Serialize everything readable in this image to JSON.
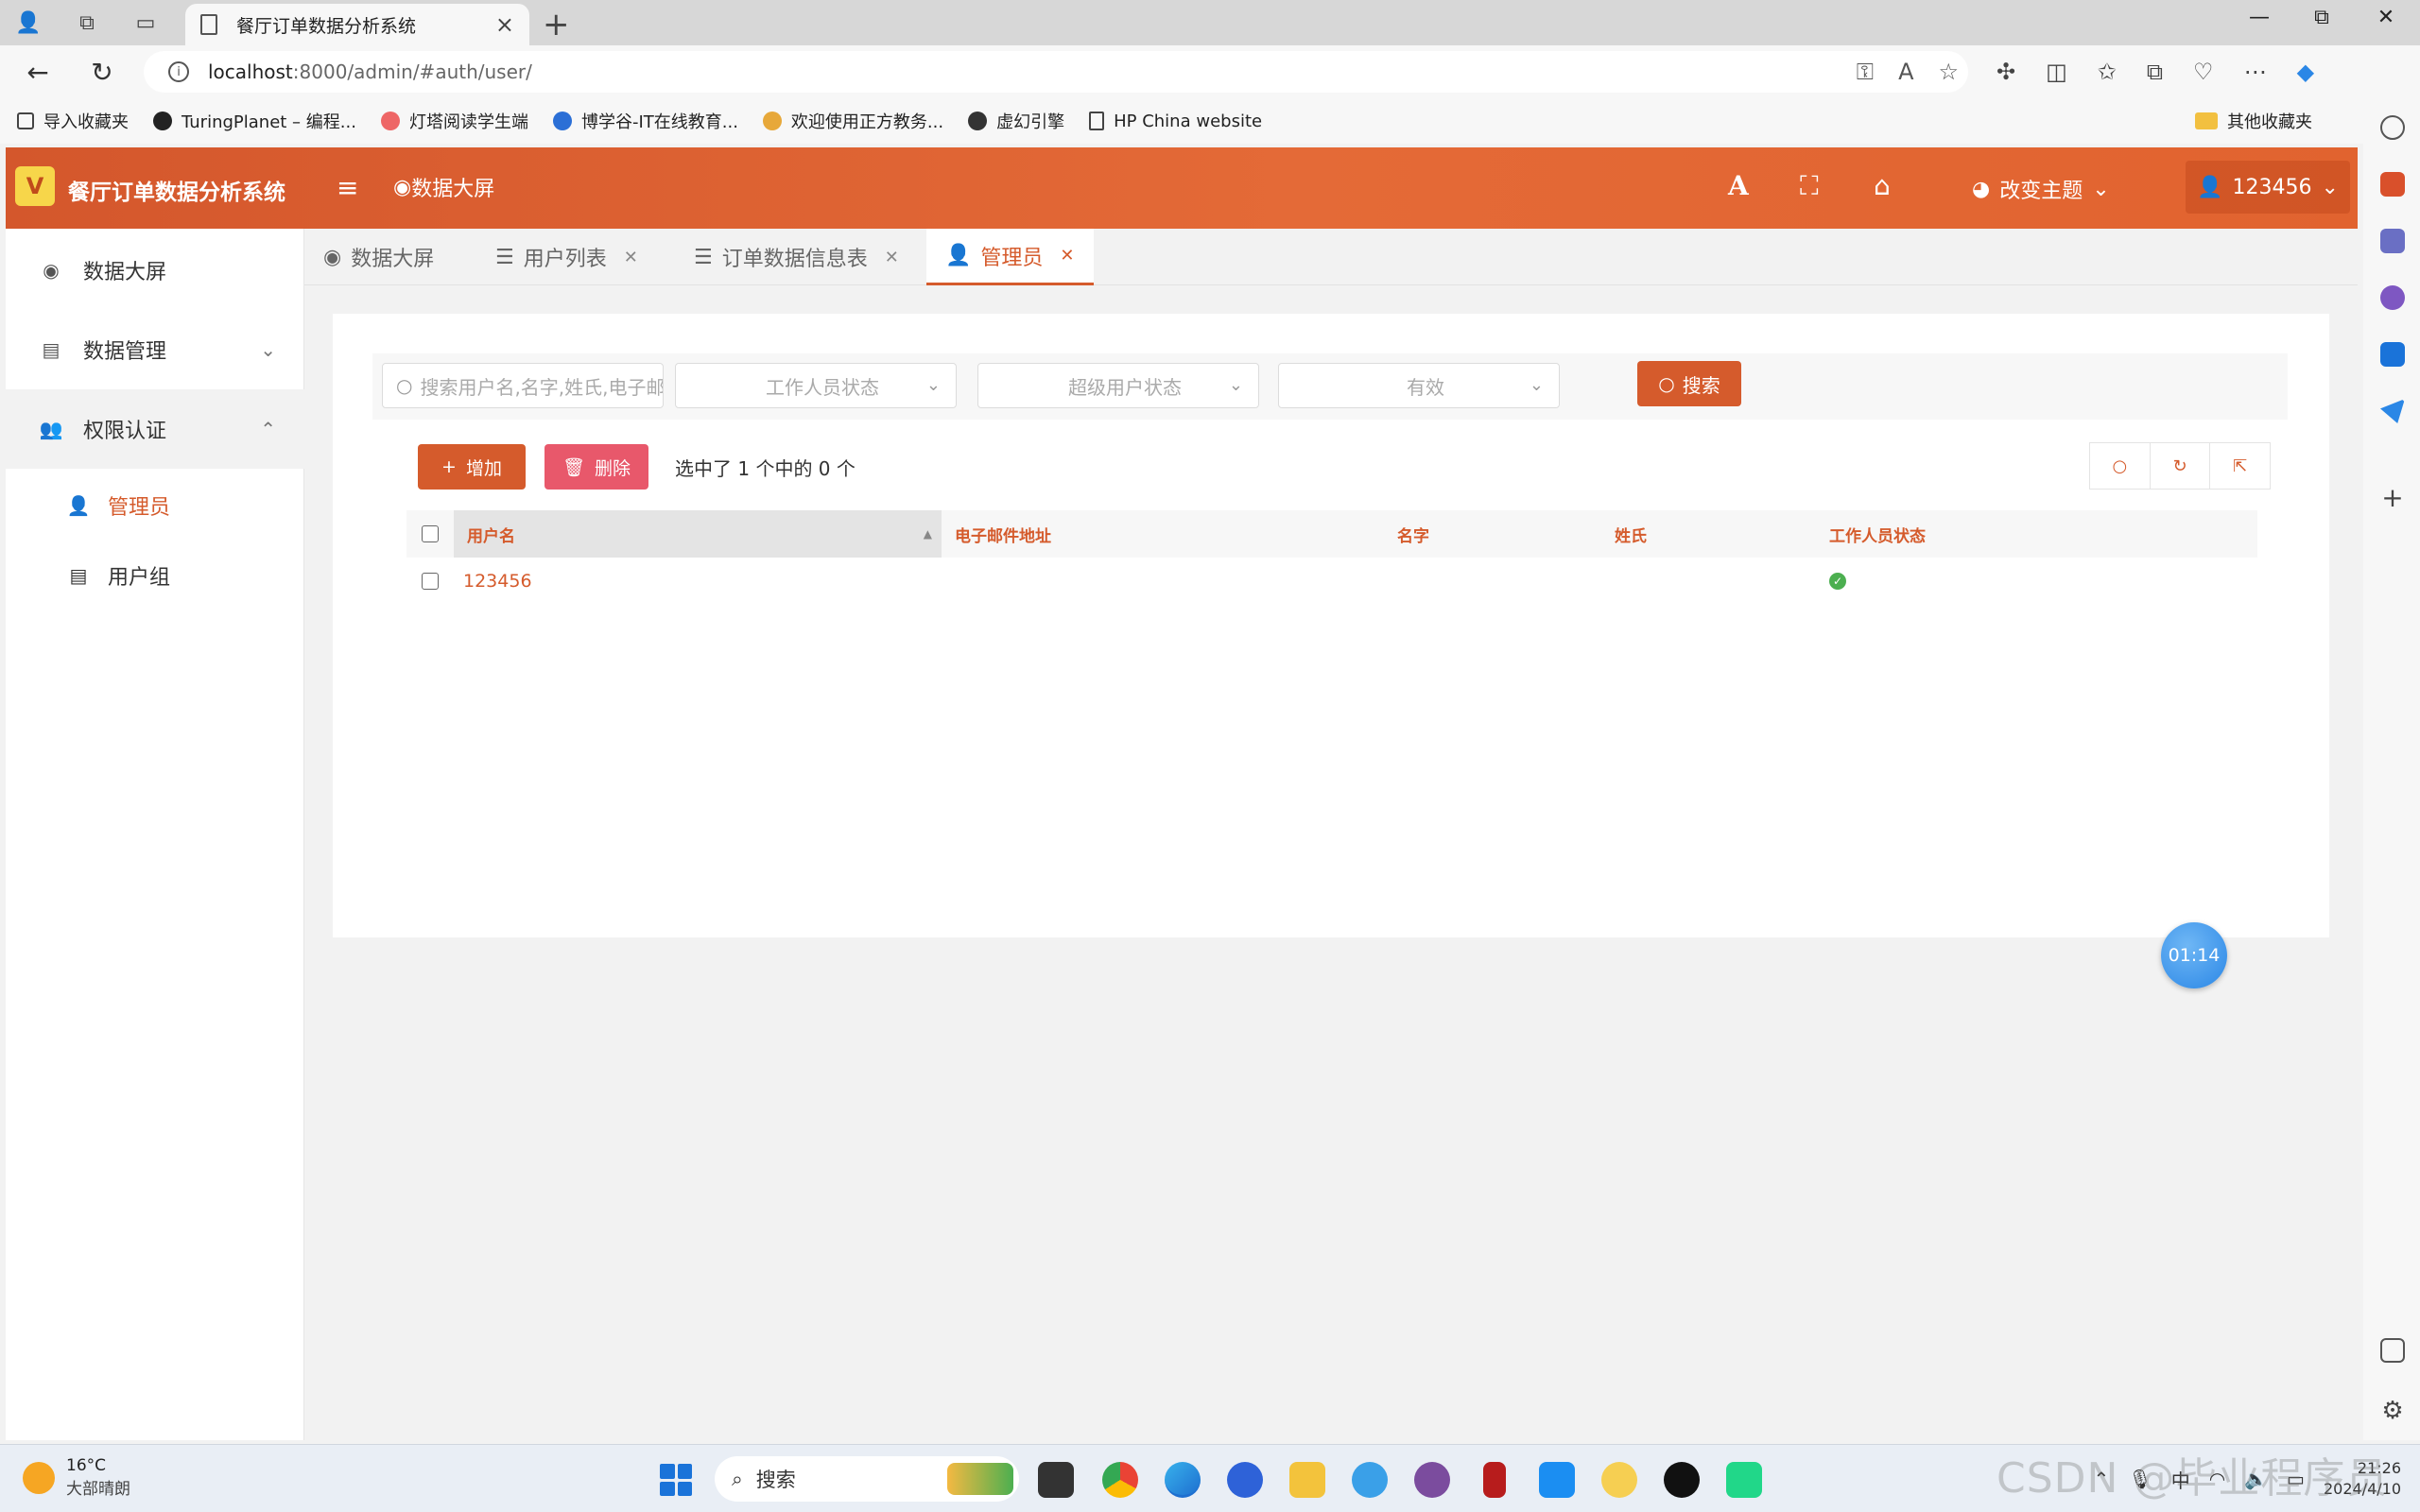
{
  "browser": {
    "tab_title": "餐厅订单数据分析系统",
    "url_host": "localhost",
    "url_rest": ":8000/admin/#auth/user/",
    "bookmarks": [
      "导入收藏夹",
      "TuringPlanet – 编程...",
      "灯塔阅读学生端",
      "博学谷-IT在线教育...",
      "欢迎使用正方教务...",
      "虚幻引擎",
      "HP China website"
    ],
    "other_bookmarks": "其他收藏夹"
  },
  "header": {
    "app_title": "餐厅订单数据分析系统",
    "dashboard_link": "数据大屏",
    "theme_label": "改变主题",
    "user_label": "123456"
  },
  "sidebar": {
    "items": [
      {
        "label": "数据大屏",
        "icon": "eye-icon"
      },
      {
        "label": "数据管理",
        "icon": "table-icon"
      },
      {
        "label": "权限认证",
        "icon": "user-lock-icon"
      }
    ],
    "sub_items": [
      {
        "label": "管理员",
        "icon": "user-icon"
      },
      {
        "label": "用户组",
        "icon": "table-icon"
      }
    ]
  },
  "page_tabs": [
    {
      "label": "数据大屏",
      "icon": "eye-icon",
      "closable": false
    },
    {
      "label": "用户列表",
      "icon": "list-icon",
      "closable": true
    },
    {
      "label": "订单数据信息表",
      "icon": "list-icon",
      "closable": true
    },
    {
      "label": "管理员",
      "icon": "user-icon",
      "closable": true,
      "active": true
    }
  ],
  "filters": {
    "search_placeholder": "搜索用户名,名字,姓氏,电子邮件地址",
    "staff_status": "工作人员状态",
    "superuser_status": "超级用户状态",
    "active_status": "有效",
    "search_button": "搜索"
  },
  "actions": {
    "add": "增加",
    "delete": "删除",
    "selection_text": "选中了 1 个中的 0 个"
  },
  "table": {
    "columns": [
      "用户名",
      "电子邮件地址",
      "名字",
      "姓氏",
      "工作人员状态"
    ],
    "rows": [
      {
        "username": "123456",
        "email": "",
        "first_name": "",
        "last_name": "",
        "is_staff": true
      }
    ]
  },
  "timer": "01:14",
  "taskbar": {
    "temperature": "16°C",
    "weather": "大部晴朗",
    "search": "搜索",
    "ime": "中",
    "time": "21:26",
    "date": "2024/4/10"
  },
  "watermark": "CSDN @毕业程序员",
  "colors": {
    "accent": "#d55b2c",
    "danger": "#e8586b",
    "success": "#4caf50"
  }
}
